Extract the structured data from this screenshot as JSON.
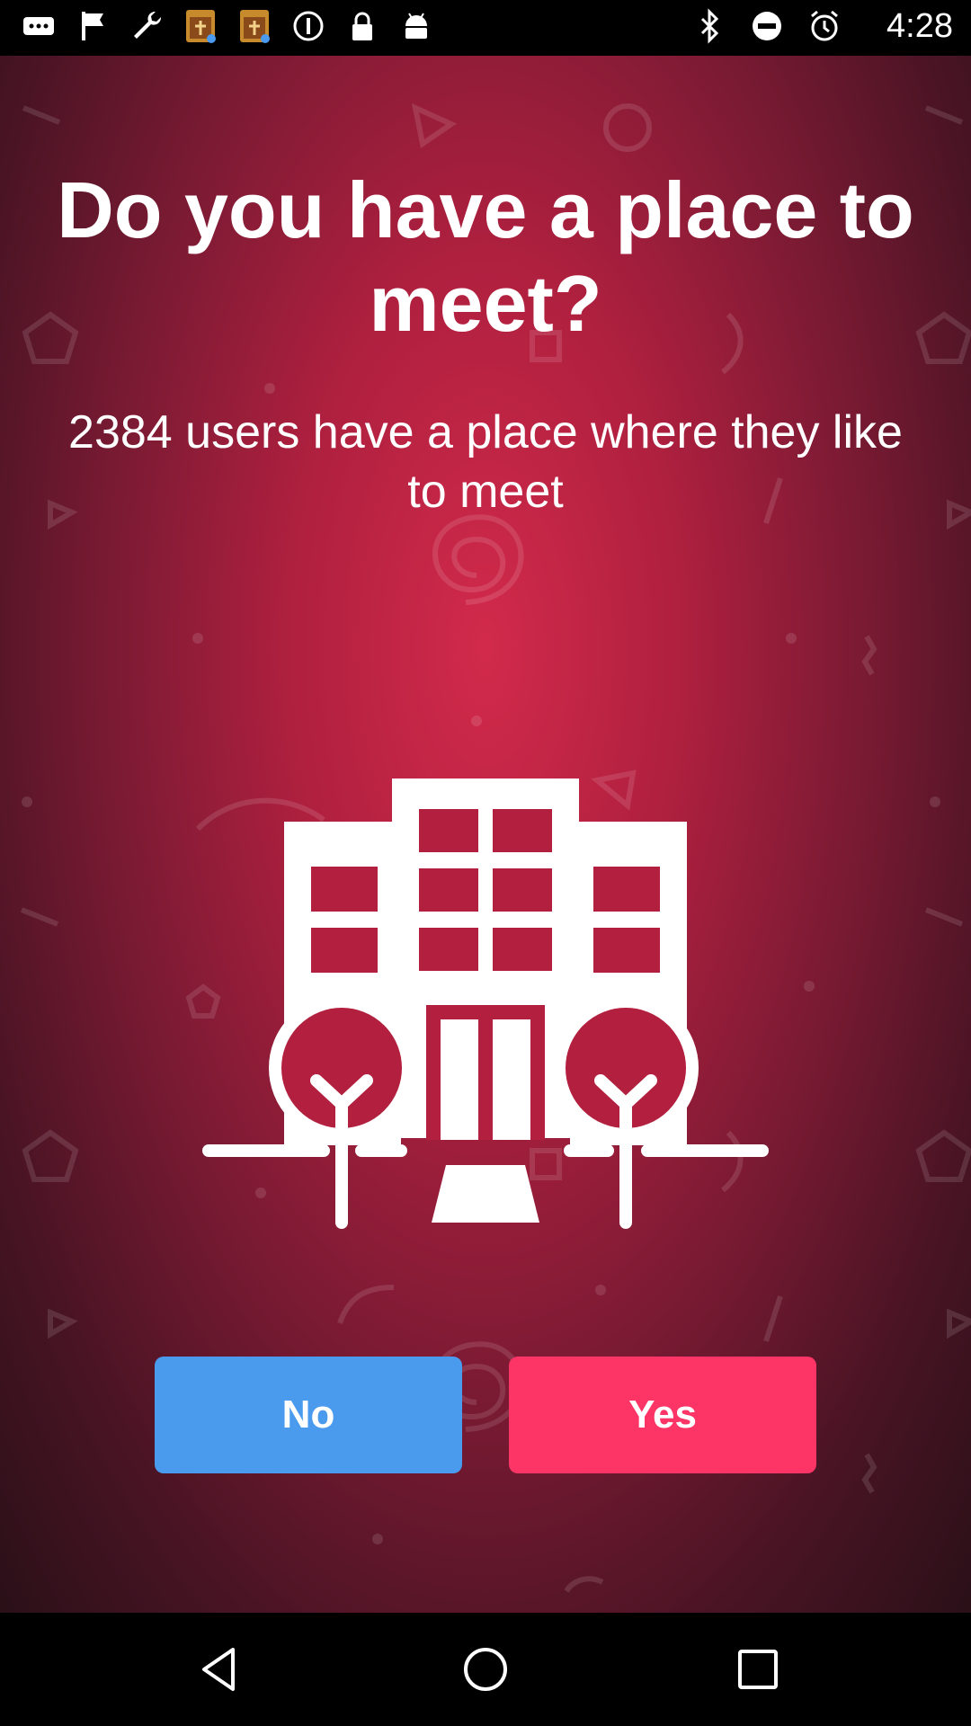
{
  "status_bar": {
    "time": "4:28",
    "left_icons": [
      "more-icon",
      "flag-icon",
      "wrench-icon",
      "topics-app-icon",
      "topics-app-icon",
      "info-icon",
      "lock-icon",
      "android-icon"
    ],
    "right_icons": [
      "bluetooth-icon",
      "do-not-disturb-icon",
      "alarm-icon"
    ]
  },
  "main": {
    "title": "Do you have a place to meet?",
    "subtitle": "2384 users have a place where they like to meet",
    "illustration_icon": "building-with-trees-icon"
  },
  "buttons": {
    "no_label": "No",
    "yes_label": "Yes"
  },
  "colors": {
    "no_button": "#4a9bee",
    "yes_button": "#fd3466",
    "background_center": "#d22a4b",
    "background_edge": "#2a1018"
  },
  "nav_bar": {
    "items": [
      "back-icon",
      "home-icon",
      "recent-apps-icon"
    ]
  }
}
